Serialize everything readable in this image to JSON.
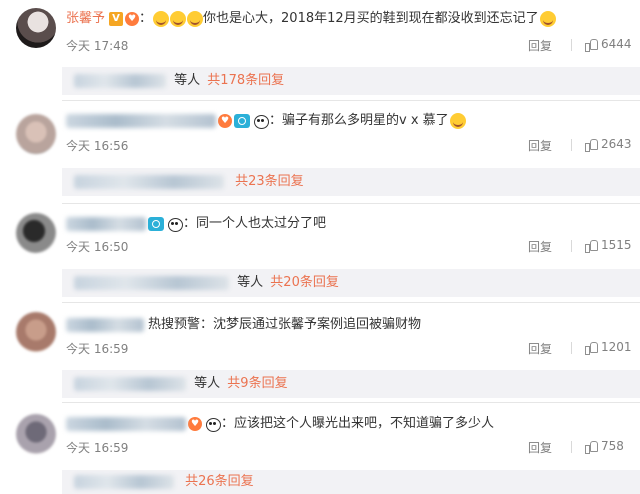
{
  "comments": [
    {
      "author": "张馨予",
      "text": "：",
      "text2": "你也是心大，2018年12月买的鞋到现在都没收到还忘记了",
      "time": "今天 17:48",
      "reply_label": "回复",
      "likes": "6444",
      "badges": [
        "verified-v-icon",
        "heart-badge-icon"
      ],
      "sub_replies": {
        "label": "等人",
        "count": "共178条回复"
      }
    },
    {
      "author": "",
      "text": "：骗子有那么多明星的v  x 慕了",
      "time": "今天 16:56",
      "reply_label": "回复",
      "likes": "2643",
      "sub_replies": {
        "label": "",
        "count": "共23条回复"
      }
    },
    {
      "author": "",
      "text": "：同一个人也太过分了吧",
      "time": "今天 16:50",
      "reply_label": "回复",
      "likes": "1515",
      "sub_replies": {
        "label": "等人",
        "count": "共20条回复"
      }
    },
    {
      "author": "",
      "text": "热搜预警：沈梦辰通过张馨予案例追回被骗财物",
      "time": "今天 16:59",
      "reply_label": "回复",
      "likes": "1201",
      "sub_replies": {
        "label": "等人",
        "count": "共9条回复"
      }
    },
    {
      "author": "",
      "text": "：应该把这个人曝光出来吧，不知道骗了多少人",
      "time": "今天 16:59",
      "reply_label": "回复",
      "likes": "758",
      "sub_replies": {
        "label": "",
        "count": "共26条回复"
      }
    }
  ],
  "colors": {
    "username": "#eb7350",
    "meta_gray": "#808080",
    "subbar_bg": "#f2f2f5"
  }
}
